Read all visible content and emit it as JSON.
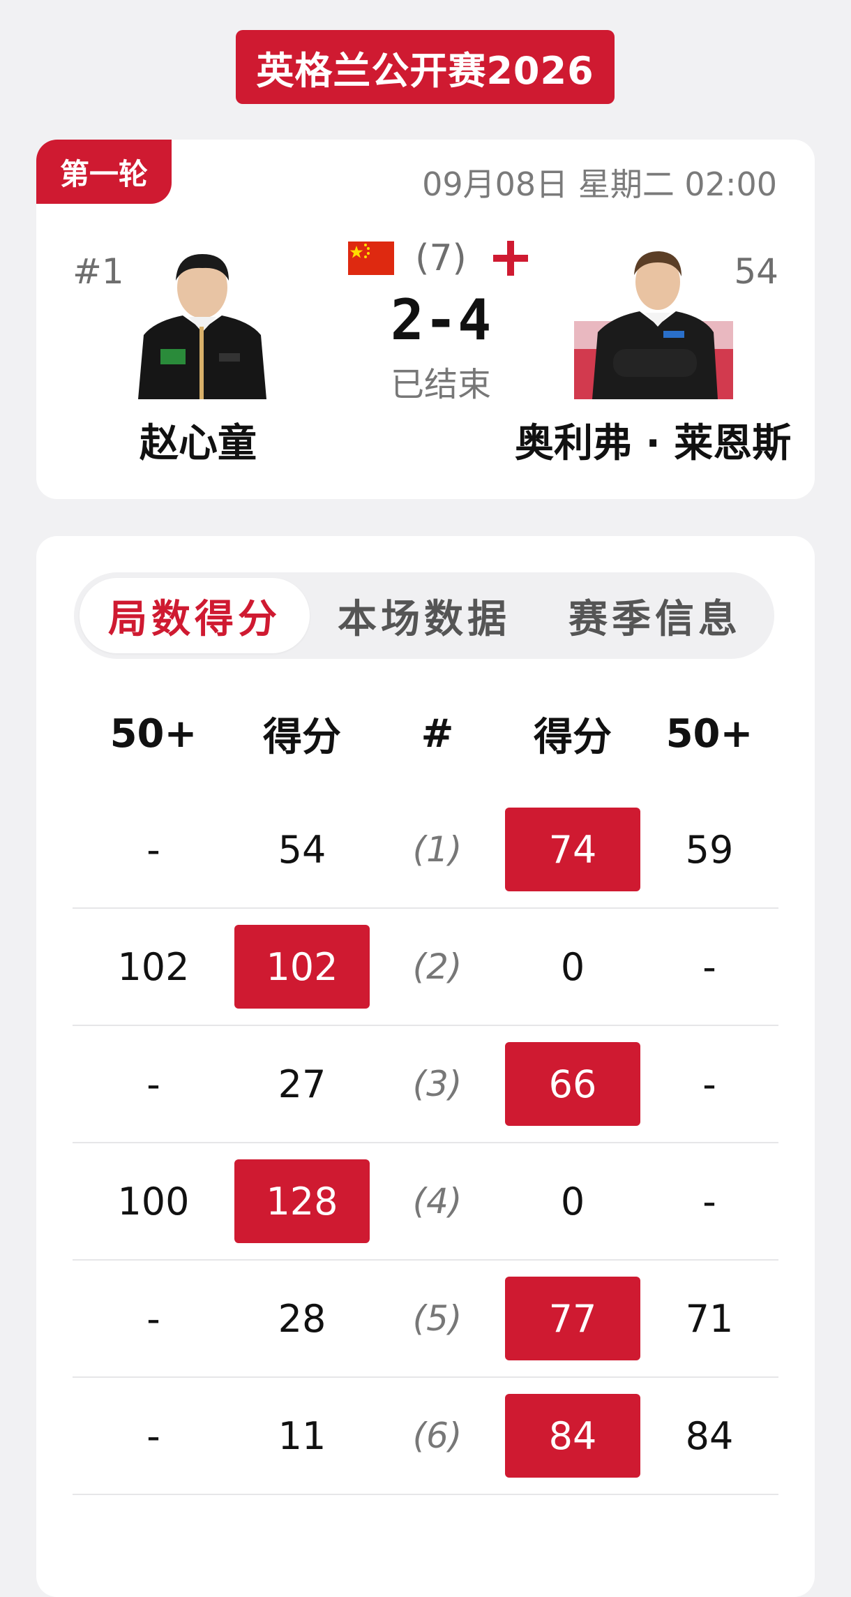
{
  "event": {
    "title": "英格兰公开赛2026"
  },
  "match": {
    "round": "第一轮",
    "datetime": "09月08日 星期二 02:00",
    "best_of": "(7)",
    "score": "2-4",
    "status": "已结束",
    "player_left": {
      "rank": "#1",
      "name": "赵心童",
      "flag": "cn-flag-icon"
    },
    "player_right": {
      "rank": "#54",
      "name": "奥利弗 · 莱恩斯",
      "flag": "england-flag-icon"
    }
  },
  "tabs": [
    {
      "label": "局数得分",
      "active": true
    },
    {
      "label": "本场数据",
      "active": false
    },
    {
      "label": "赛季信息",
      "active": false
    }
  ],
  "table": {
    "headers": [
      "50+",
      "得分",
      "#",
      "得分",
      "50+"
    ],
    "rows": [
      {
        "left_break": "-",
        "left_score": "54",
        "frame": "(1)",
        "right_score": "74",
        "right_break": "59",
        "winner": "right"
      },
      {
        "left_break": "102",
        "left_score": "102",
        "frame": "(2)",
        "right_score": "0",
        "right_break": "-",
        "winner": "left"
      },
      {
        "left_break": "-",
        "left_score": "27",
        "frame": "(3)",
        "right_score": "66",
        "right_break": "-",
        "winner": "right"
      },
      {
        "left_break": "100",
        "left_score": "128",
        "frame": "(4)",
        "right_score": "0",
        "right_break": "-",
        "winner": "left"
      },
      {
        "left_break": "-",
        "left_score": "28",
        "frame": "(5)",
        "right_score": "77",
        "right_break": "71",
        "winner": "right"
      },
      {
        "left_break": "-",
        "left_score": "11",
        "frame": "(6)",
        "right_score": "84",
        "right_break": "84",
        "winner": "right"
      }
    ]
  },
  "colors": {
    "accent": "#cf1a31",
    "background": "#f1f1f3"
  }
}
